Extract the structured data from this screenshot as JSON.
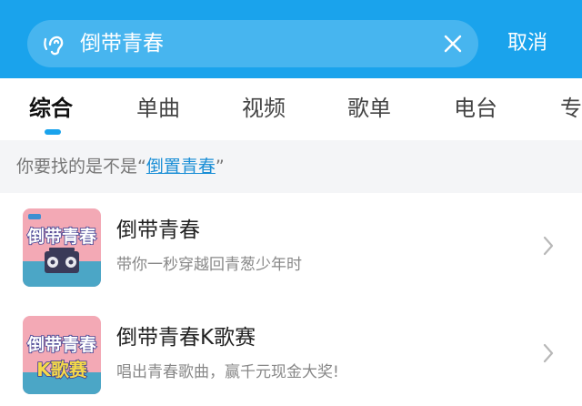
{
  "search": {
    "query": "倒带青春",
    "cancel_label": "取消",
    "voice_icon": "voice-search-icon",
    "clear_icon": "close-icon"
  },
  "tabs": [
    {
      "label": "综合",
      "active": true
    },
    {
      "label": "单曲",
      "active": false
    },
    {
      "label": "视频",
      "active": false
    },
    {
      "label": "歌单",
      "active": false
    },
    {
      "label": "电台",
      "active": false
    },
    {
      "label": "专",
      "active": false
    }
  ],
  "suggestion": {
    "prefix": "你要找的是不是“",
    "link": "倒置青春",
    "suffix": "”"
  },
  "results": [
    {
      "title": "倒带青春",
      "subtitle": "带你一秒穿越回青葱少年时",
      "cover_text": "倒带青春"
    },
    {
      "title": "倒带青春K歌赛",
      "subtitle": "唱出青春歌曲，赢千元现金大奖!",
      "cover_text": "倒带青春",
      "cover_text_2": "K歌赛"
    }
  ],
  "colors": {
    "accent": "#1aa3ec",
    "link": "#1a8ed6",
    "cover_background": "#f3a9b5",
    "cover_ground": "#4ba6c6"
  }
}
